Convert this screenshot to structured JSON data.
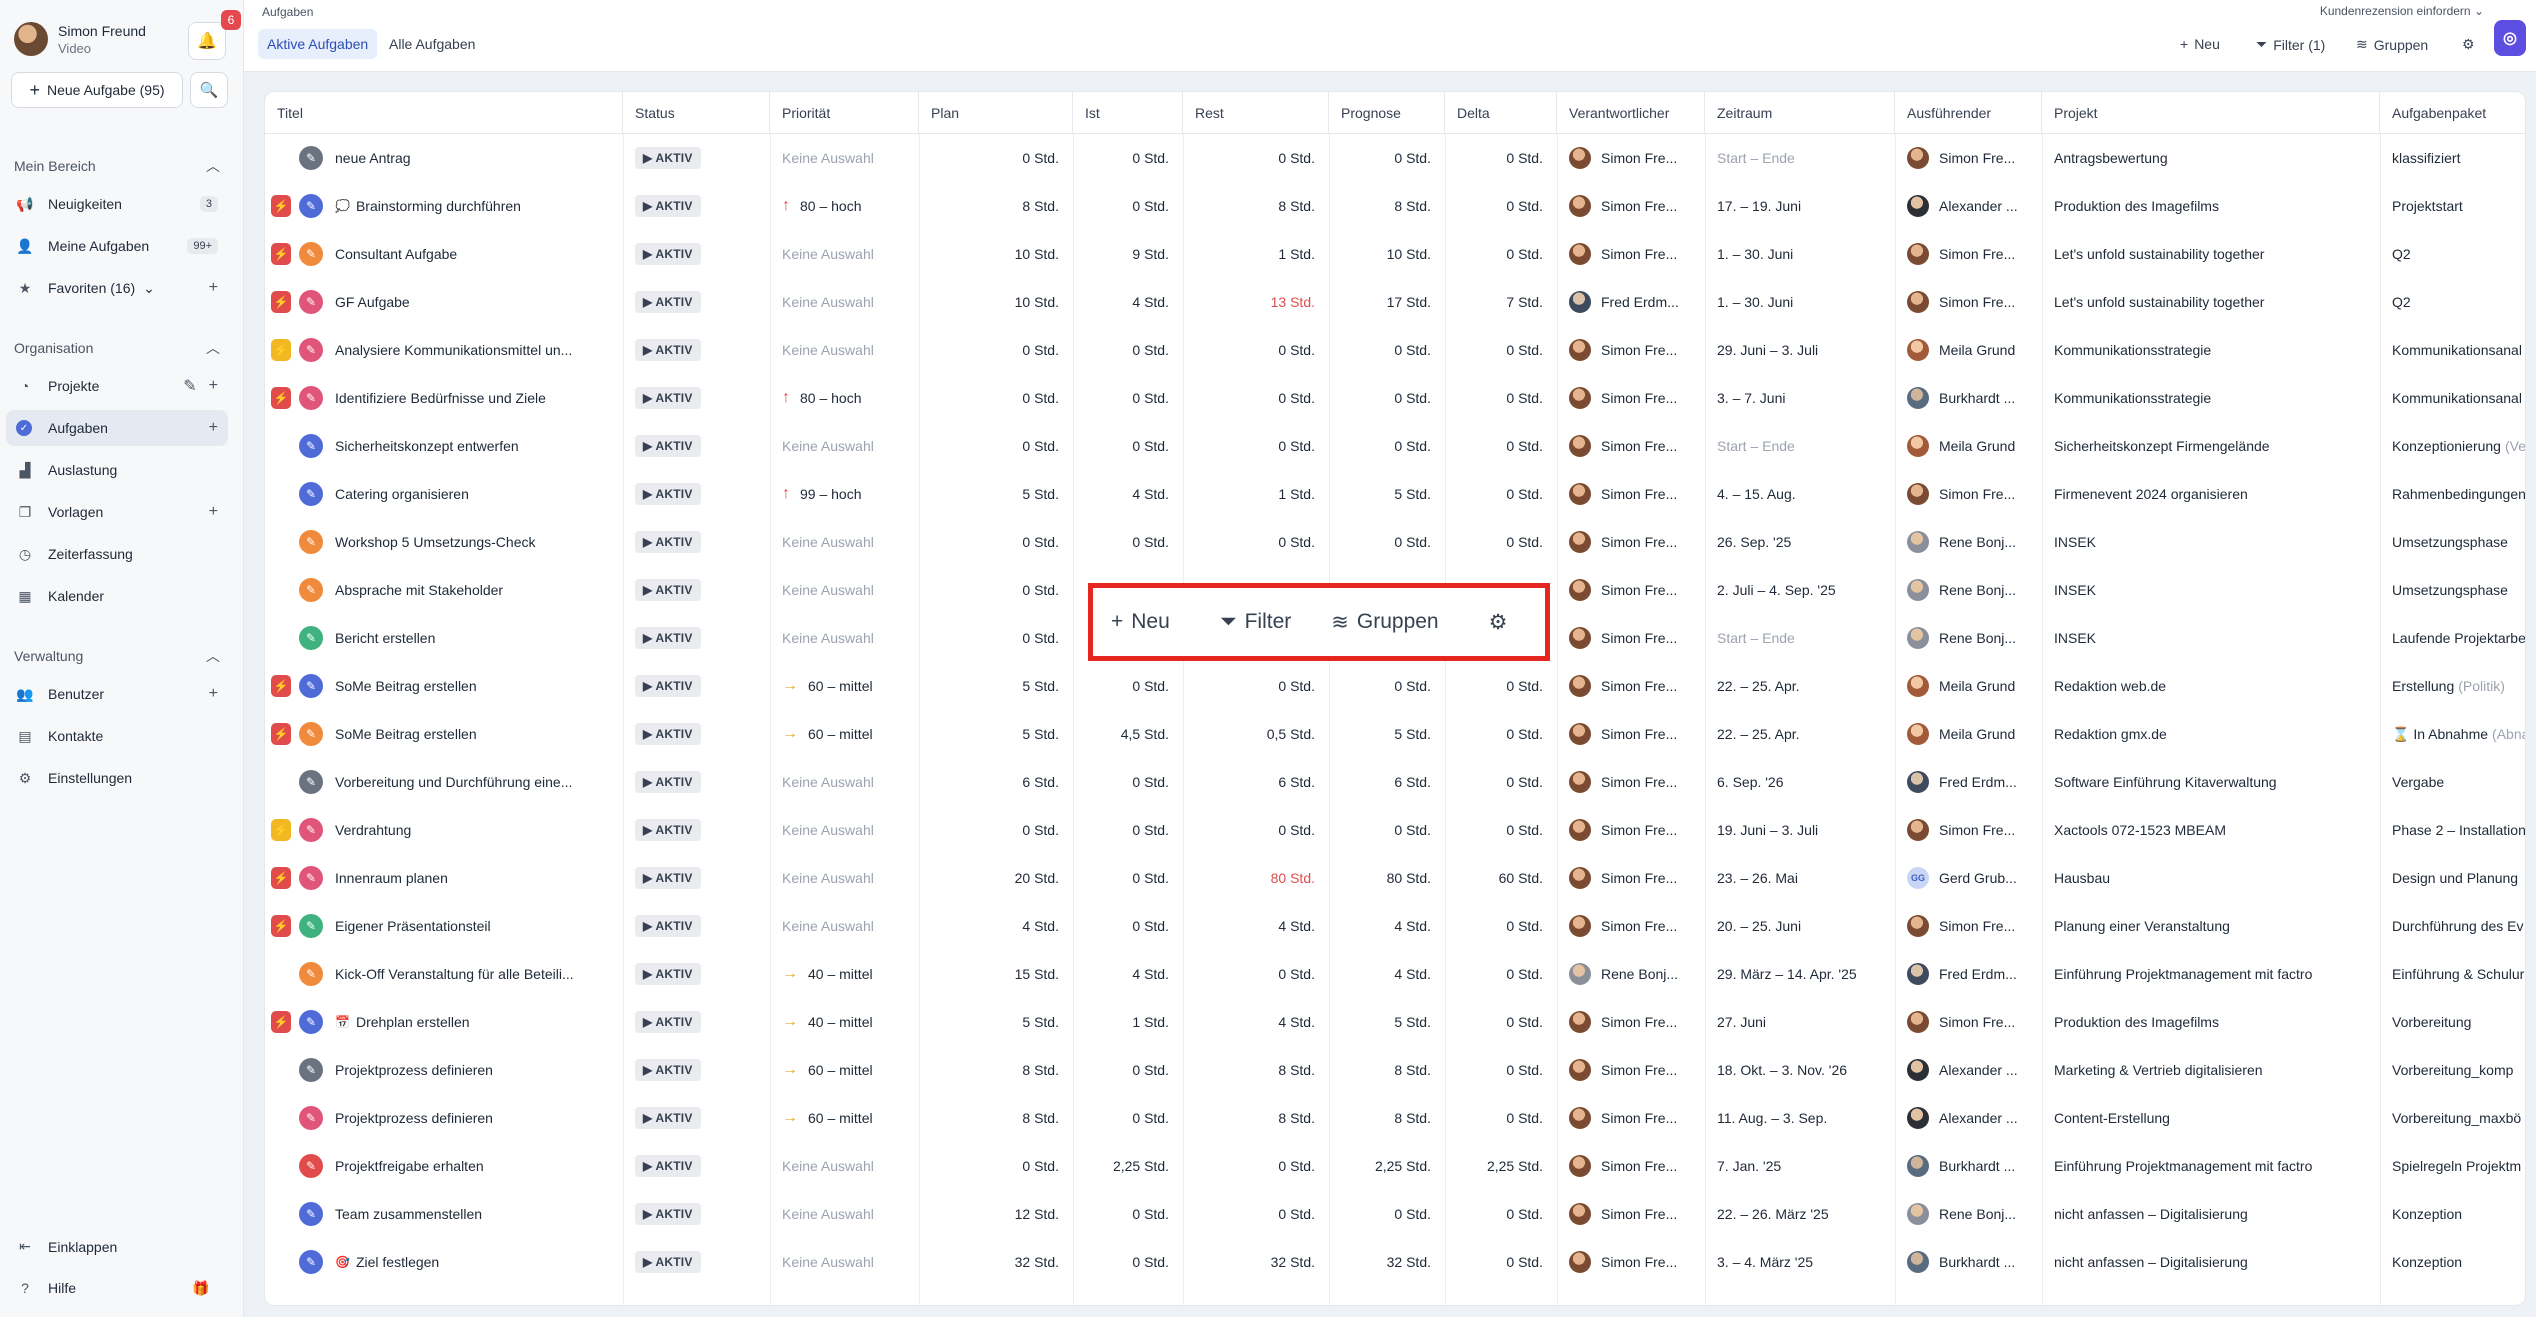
{
  "user": {
    "name": "Simon Freund",
    "subtitle": "Video",
    "notifications": "6"
  },
  "sidebar": {
    "new_task_label": "Neue Aufgabe (95)",
    "sections": [
      {
        "title": "Mein Bereich"
      },
      {
        "title": "Organisation"
      },
      {
        "title": "Verwaltung"
      }
    ],
    "items": [
      {
        "label": "Neuigkeiten",
        "icon": "megaphone-icon",
        "badge": "3"
      },
      {
        "label": "Meine Aufgaben",
        "icon": "user-icon",
        "badge": "99+"
      },
      {
        "label": "Favoriten (16)",
        "icon": "star-icon"
      },
      {
        "label": "Projekte",
        "icon": "pie-icon"
      },
      {
        "label": "Aufgaben",
        "icon": "check-circle-icon"
      },
      {
        "label": "Auslastung",
        "icon": "chart-icon"
      },
      {
        "label": "Vorlagen",
        "icon": "copy-icon"
      },
      {
        "label": "Zeiterfassung",
        "icon": "clock-icon"
      },
      {
        "label": "Kalender",
        "icon": "calendar-icon"
      },
      {
        "label": "Benutzer",
        "icon": "users-icon"
      },
      {
        "label": "Kontakte",
        "icon": "contact-icon"
      },
      {
        "label": "Einstellungen",
        "icon": "gear-icon"
      }
    ],
    "collapse_label": "Einklappen",
    "help_label": "Hilfe"
  },
  "header": {
    "breadcrumb": "Aufgaben",
    "tabs": [
      "Aktive Aufgaben",
      "Alle Aufgaben"
    ],
    "review_label": "Kundenrezension einfordern",
    "new_label": "Neu",
    "filter_label": "Filter (1)",
    "groups_label": "Gruppen"
  },
  "overlay": {
    "new_label": "Neu",
    "filter_label": "Filter",
    "groups_label": "Gruppen"
  },
  "table": {
    "columns": [
      "Titel",
      "Status",
      "Priorität",
      "Plan",
      "Ist",
      "Rest",
      "Prognose",
      "Delta",
      "Verantwortlicher",
      "Zeitraum",
      "Ausführender",
      "Projekt",
      "Aufgabenpaket"
    ],
    "rows": [
      {
        "flag": "",
        "pen": "#6b7280",
        "emoji": "",
        "title": "neue Antrag",
        "status": "▶ AKTIV",
        "prio": "Keine Auswahl",
        "prio_dir": "",
        "plan": "0 Std.",
        "ist": "0 Std.",
        "rest": "0 Std.",
        "rest_red": false,
        "prognose": "0 Std.",
        "delta": "0 Std.",
        "resp": "Simon Fre...",
        "resp_av": "a1",
        "period": "Start – Ende",
        "period_muted": true,
        "exec": "Simon Fre...",
        "exec_av": "a1",
        "project": "Antragsbewertung",
        "package": "klassifiziert",
        "package_suffix": ""
      },
      {
        "flag": "red",
        "pen": "#4e6bd8",
        "emoji": "💭",
        "title": "Brainstorming durchführen",
        "status": "▶ AKTIV",
        "prio": "80 – hoch",
        "prio_dir": "up",
        "plan": "8 Std.",
        "ist": "0 Std.",
        "rest": "8 Std.",
        "rest_red": false,
        "prognose": "8 Std.",
        "delta": "0 Std.",
        "resp": "Simon Fre...",
        "resp_av": "a1",
        "period": "17. – 19. Juni",
        "period_muted": false,
        "exec": "Alexander ...",
        "exec_av": "a3",
        "project": "Produktion des Imagefilms",
        "package": "Projektstart",
        "package_suffix": ""
      },
      {
        "flag": "red",
        "pen": "#f08a3c",
        "emoji": "",
        "title": "Consultant Aufgabe",
        "status": "▶ AKTIV",
        "prio": "Keine Auswahl",
        "prio_dir": "",
        "plan": "10 Std.",
        "ist": "9 Std.",
        "rest": "1 Std.",
        "rest_red": false,
        "prognose": "10 Std.",
        "delta": "0 Std.",
        "resp": "Simon Fre...",
        "resp_av": "a1",
        "period": "1. – 30. Juni",
        "period_muted": false,
        "exec": "Simon Fre...",
        "exec_av": "a1",
        "project": "Let's unfold sustainability together",
        "package": "Q2",
        "package_suffix": ""
      },
      {
        "flag": "red",
        "pen": "#e0557a",
        "emoji": "",
        "title": "GF Aufgabe",
        "status": "▶ AKTIV",
        "prio": "Keine Auswahl",
        "prio_dir": "",
        "plan": "10 Std.",
        "ist": "4 Std.",
        "rest": "13 Std.",
        "rest_red": true,
        "prognose": "17 Std.",
        "delta": "7 Std.",
        "resp": "Fred Erdm...",
        "resp_av": "a2",
        "period": "1. – 30. Juni",
        "period_muted": false,
        "exec": "Simon Fre...",
        "exec_av": "a1",
        "project": "Let's unfold sustainability together",
        "package": "Q2",
        "package_suffix": ""
      },
      {
        "flag": "yellow",
        "pen": "#e0557a",
        "emoji": "",
        "title": "Analysiere Kommunikationsmittel un...",
        "status": "▶ AKTIV",
        "prio": "Keine Auswahl",
        "prio_dir": "",
        "plan": "0 Std.",
        "ist": "0 Std.",
        "rest": "0 Std.",
        "rest_red": false,
        "prognose": "0 Std.",
        "delta": "0 Std.",
        "resp": "Simon Fre...",
        "resp_av": "a1",
        "period": "29. Juni – 3. Juli",
        "period_muted": false,
        "exec": "Meila Grund",
        "exec_av": "a4",
        "project": "Kommunikationsstrategie",
        "package": "Kommunikationsanal",
        "package_suffix": ""
      },
      {
        "flag": "red",
        "pen": "#e0557a",
        "emoji": "",
        "title": "Identifiziere Bedürfnisse und Ziele",
        "status": "▶ AKTIV",
        "prio": "80 – hoch",
        "prio_dir": "up",
        "plan": "0 Std.",
        "ist": "0 Std.",
        "rest": "0 Std.",
        "rest_red": false,
        "prognose": "0 Std.",
        "delta": "0 Std.",
        "resp": "Simon Fre...",
        "resp_av": "a1",
        "period": "3. – 7. Juni",
        "period_muted": false,
        "exec": "Burkhardt ...",
        "exec_av": "a5",
        "project": "Kommunikationsstrategie",
        "package": "Kommunikationsanal",
        "package_suffix": ""
      },
      {
        "flag": "",
        "pen": "#4e6bd8",
        "emoji": "",
        "title": "Sicherheitskonzept entwerfen",
        "status": "▶ AKTIV",
        "prio": "Keine Auswahl",
        "prio_dir": "",
        "plan": "0 Std.",
        "ist": "0 Std.",
        "rest": "0 Std.",
        "rest_red": false,
        "prognose": "0 Std.",
        "delta": "0 Std.",
        "resp": "Simon Fre...",
        "resp_av": "a1",
        "period": "Start – Ende",
        "period_muted": true,
        "exec": "Meila Grund",
        "exec_av": "a4",
        "project": "Sicherheitskonzept Firmengelände",
        "package": "Konzeptionierung",
        "package_suffix": "(Ve"
      },
      {
        "flag": "",
        "pen": "#4e6bd8",
        "emoji": "",
        "title": "Catering organisieren",
        "status": "▶ AKTIV",
        "prio": "99 – hoch",
        "prio_dir": "up",
        "plan": "5 Std.",
        "ist": "4 Std.",
        "rest": "1 Std.",
        "rest_red": false,
        "prognose": "5 Std.",
        "delta": "0 Std.",
        "resp": "Simon Fre...",
        "resp_av": "a1",
        "period": "4. – 15. Aug.",
        "period_muted": false,
        "exec": "Simon Fre...",
        "exec_av": "a1",
        "project": "Firmenevent 2024 organisieren",
        "package": "Rahmenbedingungen",
        "package_suffix": ""
      },
      {
        "flag": "",
        "pen": "#f08a3c",
        "emoji": "",
        "title": "Workshop 5 Umsetzungs-Check",
        "status": "▶ AKTIV",
        "prio": "Keine Auswahl",
        "prio_dir": "",
        "plan": "0 Std.",
        "ist": "0 Std.",
        "rest": "0 Std.",
        "rest_red": false,
        "prognose": "0 Std.",
        "delta": "0 Std.",
        "resp": "Simon Fre...",
        "resp_av": "a1",
        "period": "26. Sep. '25",
        "period_muted": false,
        "exec": "Rene Bonj...",
        "exec_av": "a6",
        "project": "INSEK",
        "package": "Umsetzungsphase",
        "package_suffix": ""
      },
      {
        "flag": "",
        "pen": "#f08a3c",
        "emoji": "",
        "title": "Absprache mit Stakeholder",
        "status": "▶ AKTIV",
        "prio": "Keine Auswahl",
        "prio_dir": "",
        "plan": "0 Std.",
        "ist": "",
        "rest": "",
        "rest_red": false,
        "prognose": "",
        "delta": "",
        "resp": "Simon Fre...",
        "resp_av": "a1",
        "period": "2. Juli – 4. Sep. '25",
        "period_muted": false,
        "exec": "Rene Bonj...",
        "exec_av": "a6",
        "project": "INSEK",
        "package": "Umsetzungsphase",
        "package_suffix": ""
      },
      {
        "flag": "",
        "pen": "#3fb27f",
        "emoji": "",
        "title": "Bericht erstellen",
        "status": "▶ AKTIV",
        "prio": "Keine Auswahl",
        "prio_dir": "",
        "plan": "0 Std.",
        "ist": "",
        "rest": "",
        "rest_red": false,
        "prognose": "",
        "delta": "",
        "resp": "Simon Fre...",
        "resp_av": "a1",
        "period": "Start – Ende",
        "period_muted": true,
        "exec": "Rene Bonj...",
        "exec_av": "a6",
        "project": "INSEK",
        "package": "Laufende Projektarbe",
        "package_suffix": ""
      },
      {
        "flag": "red",
        "pen": "#4e6bd8",
        "emoji": "",
        "title": "SoMe Beitrag erstellen",
        "status": "▶ AKTIV",
        "prio": "60 – mittel",
        "prio_dir": "right",
        "plan": "5 Std.",
        "ist": "0 Std.",
        "rest": "0 Std.",
        "rest_red": false,
        "prognose": "0 Std.",
        "delta": "0 Std.",
        "resp": "Simon Fre...",
        "resp_av": "a1",
        "period": "22. – 25. Apr.",
        "period_muted": false,
        "exec": "Meila Grund",
        "exec_av": "a4",
        "project": "Redaktion web.de",
        "package": "Erstellung",
        "package_suffix": "(Politik)"
      },
      {
        "flag": "red",
        "pen": "#f08a3c",
        "emoji": "",
        "title": "SoMe Beitrag erstellen",
        "status": "▶ AKTIV",
        "prio": "60 – mittel",
        "prio_dir": "right",
        "plan": "5 Std.",
        "ist": "4,5 Std.",
        "rest": "0,5 Std.",
        "rest_red": false,
        "prognose": "5 Std.",
        "delta": "0 Std.",
        "resp": "Simon Fre...",
        "resp_av": "a1",
        "period": "22. – 25. Apr.",
        "period_muted": false,
        "exec": "Meila Grund",
        "exec_av": "a4",
        "project": "Redaktion gmx.de",
        "package": "⌛ In Abnahme",
        "package_suffix": "(Abna"
      },
      {
        "flag": "",
        "pen": "#6b7280",
        "emoji": "",
        "title": "Vorbereitung und Durchführung eine...",
        "status": "▶ AKTIV",
        "prio": "Keine Auswahl",
        "prio_dir": "",
        "plan": "6 Std.",
        "ist": "0 Std.",
        "rest": "6 Std.",
        "rest_red": false,
        "prognose": "6 Std.",
        "delta": "0 Std.",
        "resp": "Simon Fre...",
        "resp_av": "a1",
        "period": "6. Sep. '26",
        "period_muted": false,
        "exec": "Fred Erdm...",
        "exec_av": "a2",
        "project": "Software Einführung Kitaverwaltung",
        "package": "Vergabe",
        "package_suffix": ""
      },
      {
        "flag": "yellow",
        "pen": "#e0557a",
        "emoji": "",
        "title": "Verdrahtung",
        "status": "▶ AKTIV",
        "prio": "Keine Auswahl",
        "prio_dir": "",
        "plan": "0 Std.",
        "ist": "0 Std.",
        "rest": "0 Std.",
        "rest_red": false,
        "prognose": "0 Std.",
        "delta": "0 Std.",
        "resp": "Simon Fre...",
        "resp_av": "a1",
        "period": "19. Juni – 3. Juli",
        "period_muted": false,
        "exec": "Simon Fre...",
        "exec_av": "a1",
        "project": "Xactools 072-1523 MBEAM",
        "package": "Phase 2 – Installation",
        "package_suffix": ""
      },
      {
        "flag": "red",
        "pen": "#e0557a",
        "emoji": "",
        "title": "Innenraum planen",
        "status": "▶ AKTIV",
        "prio": "Keine Auswahl",
        "prio_dir": "",
        "plan": "20 Std.",
        "ist": "0 Std.",
        "rest": "80 Std.",
        "rest_red": true,
        "prognose": "80 Std.",
        "delta": "60 Std.",
        "resp": "Simon Fre...",
        "resp_av": "a1",
        "period": "23. – 26. Mai",
        "period_muted": false,
        "exec": "Gerd Grub...",
        "exec_av": "gg",
        "project": "Hausbau",
        "package": "Design und Planung",
        "package_suffix": ""
      },
      {
        "flag": "red",
        "pen": "#3fb27f",
        "emoji": "",
        "title": "Eigener Präsentationsteil",
        "status": "▶ AKTIV",
        "prio": "Keine Auswahl",
        "prio_dir": "",
        "plan": "4 Std.",
        "ist": "0 Std.",
        "rest": "4 Std.",
        "rest_red": false,
        "prognose": "4 Std.",
        "delta": "0 Std.",
        "resp": "Simon Fre...",
        "resp_av": "a1",
        "period": "20. – 25. Juni",
        "period_muted": false,
        "exec": "Simon Fre...",
        "exec_av": "a1",
        "project": "Planung einer Veranstaltung",
        "package": "Durchführung des Ev",
        "package_suffix": ""
      },
      {
        "flag": "",
        "pen": "#f08a3c",
        "emoji": "",
        "title": "Kick-Off Veranstaltung für alle Beteili...",
        "status": "▶ AKTIV",
        "prio": "40 – mittel",
        "prio_dir": "right",
        "plan": "15 Std.",
        "ist": "4 Std.",
        "rest": "0 Std.",
        "rest_red": false,
        "prognose": "4 Std.",
        "delta": "0 Std.",
        "resp": "Rene Bonj...",
        "resp_av": "a6",
        "period": "29. März – 14. Apr. '25",
        "period_muted": false,
        "exec": "Fred Erdm...",
        "exec_av": "a2",
        "project": "Einführung Projektmanagement mit factro",
        "package": "Einführung & Schulur",
        "package_suffix": ""
      },
      {
        "flag": "red",
        "pen": "#4e6bd8",
        "emoji": "📅",
        "title": "Drehplan erstellen",
        "status": "▶ AKTIV",
        "prio": "40 – mittel",
        "prio_dir": "right",
        "plan": "5 Std.",
        "ist": "1 Std.",
        "rest": "4 Std.",
        "rest_red": false,
        "prognose": "5 Std.",
        "delta": "0 Std.",
        "resp": "Simon Fre...",
        "resp_av": "a1",
        "period": "27. Juni",
        "period_muted": false,
        "exec": "Simon Fre...",
        "exec_av": "a1",
        "project": "Produktion des Imagefilms",
        "package": "Vorbereitung",
        "package_suffix": ""
      },
      {
        "flag": "",
        "pen": "#6b7280",
        "emoji": "",
        "title": "Projektprozess definieren",
        "status": "▶ AKTIV",
        "prio": "60 – mittel",
        "prio_dir": "right",
        "plan": "8 Std.",
        "ist": "0 Std.",
        "rest": "8 Std.",
        "rest_red": false,
        "prognose": "8 Std.",
        "delta": "0 Std.",
        "resp": "Simon Fre...",
        "resp_av": "a1",
        "period": "18. Okt. – 3. Nov. '26",
        "period_muted": false,
        "exec": "Alexander ...",
        "exec_av": "a3",
        "project": "Marketing & Vertrieb digitalisieren",
        "package": "Vorbereitung_komp",
        "package_suffix": ""
      },
      {
        "flag": "",
        "pen": "#e0557a",
        "emoji": "",
        "title": "Projektprozess definieren",
        "status": "▶ AKTIV",
        "prio": "60 – mittel",
        "prio_dir": "right",
        "plan": "8 Std.",
        "ist": "0 Std.",
        "rest": "8 Std.",
        "rest_red": false,
        "prognose": "8 Std.",
        "delta": "0 Std.",
        "resp": "Simon Fre...",
        "resp_av": "a1",
        "period": "11. Aug. – 3. Sep.",
        "period_muted": false,
        "exec": "Alexander ...",
        "exec_av": "a3",
        "project": "Content-Erstellung",
        "package": "Vorbereitung_maxbö",
        "package_suffix": ""
      },
      {
        "flag": "",
        "pen": "#e24b4b",
        "emoji": "",
        "title": "Projektfreigabe erhalten",
        "status": "▶ AKTIV",
        "prio": "Keine Auswahl",
        "prio_dir": "",
        "plan": "0 Std.",
        "ist": "2,25 Std.",
        "rest": "0 Std.",
        "rest_red": false,
        "prognose": "2,25 Std.",
        "delta": "2,25 Std.",
        "resp": "Simon Fre...",
        "resp_av": "a1",
        "period": "7. Jan. '25",
        "period_muted": false,
        "exec": "Burkhardt ...",
        "exec_av": "a5",
        "project": "Einführung Projektmanagement mit factro",
        "package": "Spielregeln Projektm",
        "package_suffix": ""
      },
      {
        "flag": "",
        "pen": "#4e6bd8",
        "emoji": "",
        "title": "Team zusammenstellen",
        "status": "▶ AKTIV",
        "prio": "Keine Auswahl",
        "prio_dir": "",
        "plan": "12 Std.",
        "ist": "0 Std.",
        "rest": "0 Std.",
        "rest_red": false,
        "prognose": "0 Std.",
        "delta": "0 Std.",
        "resp": "Simon Fre...",
        "resp_av": "a1",
        "period": "22. – 26. März '25",
        "period_muted": false,
        "exec": "Rene Bonj...",
        "exec_av": "a6",
        "project": "nicht anfassen – Digitalisierung",
        "package": "Konzeption",
        "package_suffix": ""
      },
      {
        "flag": "",
        "pen": "#4e6bd8",
        "emoji": "🎯",
        "title": "Ziel festlegen",
        "status": "▶ AKTIV",
        "prio": "Keine Auswahl",
        "prio_dir": "",
        "plan": "32 Std.",
        "ist": "0 Std.",
        "rest": "32 Std.",
        "rest_red": false,
        "prognose": "32 Std.",
        "delta": "0 Std.",
        "resp": "Simon Fre...",
        "resp_av": "a1",
        "period": "3. – 4. März '25",
        "period_muted": false,
        "exec": "Burkhardt ...",
        "exec_av": "a5",
        "project": "nicht anfassen – Digitalisierung",
        "package": "Konzeption",
        "package_suffix": ""
      }
    ]
  }
}
